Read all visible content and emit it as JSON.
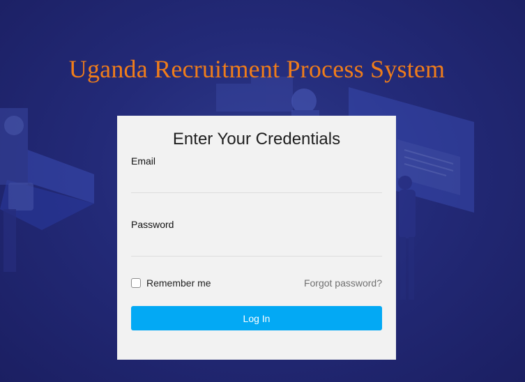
{
  "page": {
    "title": "Uganda Recruitment Process System"
  },
  "login": {
    "heading": "Enter Your Credentials",
    "email_label": "Email",
    "email_value": "",
    "password_label": "Password",
    "password_value": "",
    "remember_label": "Remember me",
    "remember_checked": false,
    "forgot_label": "Forgot password?",
    "submit_label": "Log In"
  },
  "colors": {
    "background": "#232a78",
    "title": "#f07d1a",
    "card": "#f2f2f2",
    "button": "#03a9f4"
  }
}
